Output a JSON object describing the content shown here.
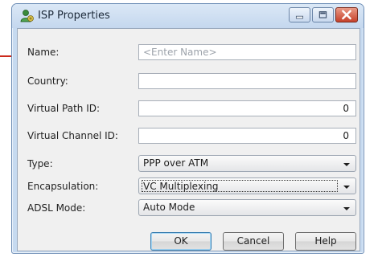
{
  "window": {
    "title": "ISP Properties",
    "icon": "isp-user-icon",
    "controls": [
      "minimize-icon",
      "maximize-icon",
      "close-icon"
    ]
  },
  "form": {
    "name": {
      "label": "Name:",
      "value": "",
      "placeholder": "<Enter Name>"
    },
    "country": {
      "label": "Country:",
      "value": ""
    },
    "vpi": {
      "label": "Virtual Path ID:",
      "value": "0"
    },
    "vci": {
      "label": "Virtual Channel ID:",
      "value": "0"
    },
    "type": {
      "label": "Type:",
      "value": "PPP over ATM"
    },
    "encapsulation": {
      "label": "Encapsulation:",
      "value": "VC Multiplexing"
    },
    "adsl_mode": {
      "label": "ADSL Mode:",
      "value": "Auto Mode"
    }
  },
  "buttons": {
    "ok": "OK",
    "cancel": "Cancel",
    "help": "Help"
  },
  "colors": {
    "accent_line": "#cc2a1c",
    "title_bar": "#c4d7ee",
    "close_button": "#c6412b"
  }
}
